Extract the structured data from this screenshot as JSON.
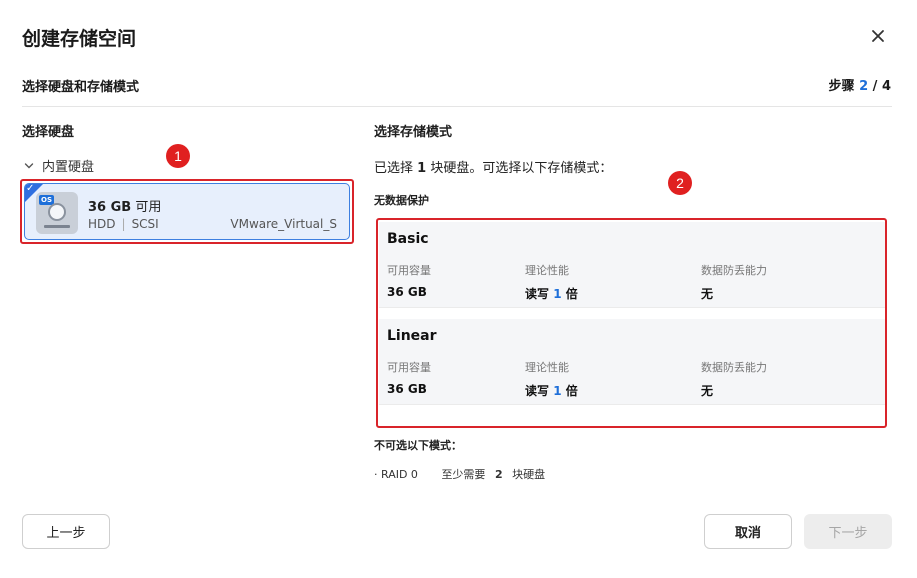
{
  "dialog": {
    "title": "创建存储空间",
    "subtitle": "选择硬盘和存储模式",
    "steps": {
      "label": "步骤",
      "current": "2",
      "separator": "/",
      "total": "4"
    }
  },
  "disk_panel": {
    "title": "选择硬盘",
    "group_label": "内置硬盘",
    "disk": {
      "os_badge": "OS",
      "size": "36 GB",
      "available": "可用",
      "type": "HDD",
      "interface": "SCSI",
      "model": "VMware_Virtual_S"
    }
  },
  "mode_panel": {
    "title": "选择存储模式",
    "hint_prefix": "已选择",
    "hint_count": "1",
    "hint_suffix": "块硬盘。可选择以下存储模式：",
    "no_protection_label": "无数据保护",
    "column_labels": {
      "capacity": "可用容量",
      "performance": "理论性能",
      "protection": "数据防丢能力"
    },
    "modes": [
      {
        "name": "Basic",
        "capacity": "36 GB",
        "perf_prefix": "读写",
        "perf_value": "1",
        "perf_suffix": "倍",
        "protection": "无"
      },
      {
        "name": "Linear",
        "capacity": "36 GB",
        "perf_prefix": "读写",
        "perf_value": "1",
        "perf_suffix": "倍",
        "protection": "无"
      }
    ],
    "unavailable_label": "不可选以下模式：",
    "unavailable": [
      {
        "name": "· RAID 0",
        "req_prefix": "至少需要",
        "req_count": "2",
        "req_suffix": "块硬盘"
      }
    ]
  },
  "annotations": {
    "badge1": "1",
    "badge2": "2",
    "color": "#e02020"
  },
  "footer": {
    "prev_label": "上一步",
    "cancel_label": "取消",
    "next_label": "下一步"
  },
  "colors": {
    "accent": "#1e6fd9",
    "selected_bg": "#e7effc",
    "highlight": "#d9242a"
  }
}
